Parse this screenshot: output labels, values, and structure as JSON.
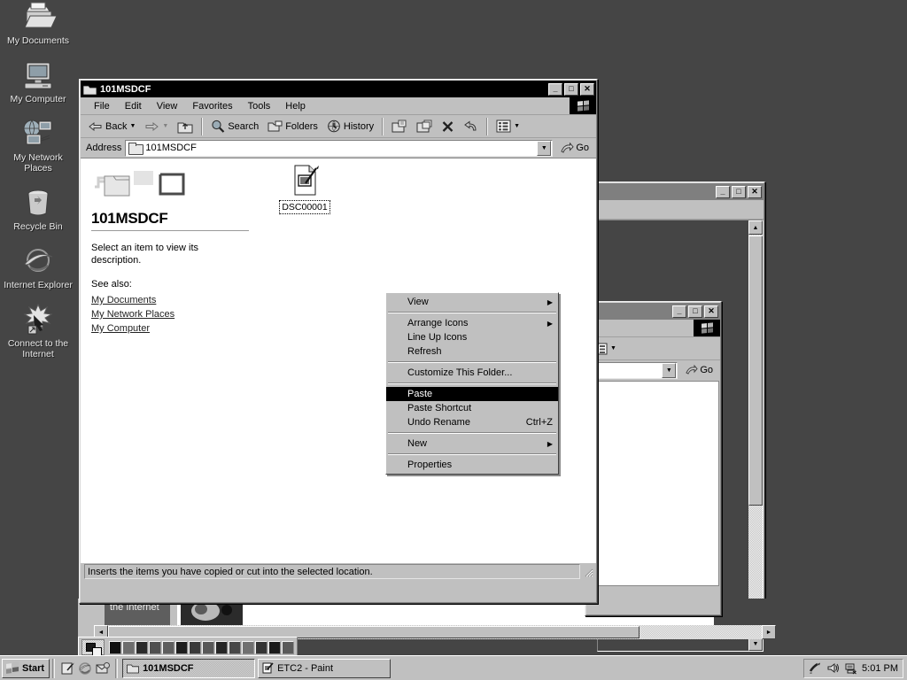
{
  "desktop": {
    "background_color": "#454545",
    "icons": [
      {
        "name": "my-documents",
        "label": "My Documents",
        "icon": "documents-folder-icon"
      },
      {
        "name": "my-computer",
        "label": "My Computer",
        "icon": "computer-icon"
      },
      {
        "name": "my-network-places",
        "label": "My Network Places",
        "icon": "network-icon"
      },
      {
        "name": "recycle-bin",
        "label": "Recycle Bin",
        "icon": "recycle-bin-icon"
      },
      {
        "name": "internet-explorer",
        "label": "Internet Explorer",
        "icon": "internet-explorer-icon"
      },
      {
        "name": "connect-to-internet",
        "label": "Connect to the Internet",
        "icon": "connect-wizard-icon"
      }
    ]
  },
  "explorer": {
    "title": "101MSDCF",
    "title_icon": "folder-icon",
    "window_controls": {
      "minimize": "_",
      "maximize": "□",
      "close": "✕"
    },
    "menus": [
      "File",
      "Edit",
      "View",
      "Favorites",
      "Tools",
      "Help"
    ],
    "toolbar": {
      "back": "Back",
      "forward": "",
      "up": "",
      "search": "Search",
      "folders": "Folders",
      "history": "History",
      "move_to": "",
      "copy_to": "",
      "delete": "",
      "undo": "",
      "views": ""
    },
    "address": {
      "label": "Address",
      "value": "101MSDCF",
      "go_label": "Go"
    },
    "sidebar": {
      "title": "101MSDCF",
      "description": "Select an item to view its description.",
      "see_also_label": "See also:",
      "links": [
        "My Documents",
        "My Network Places",
        "My Computer"
      ]
    },
    "files": [
      {
        "name": "DSC00001",
        "icon": "paint-document-icon",
        "selected": true
      }
    ],
    "status": "Inserts the items you have copied or cut into the selected location."
  },
  "context_menu": {
    "items": [
      {
        "label": "View",
        "submenu": true,
        "accel": "",
        "selected": false,
        "separator_after": true
      },
      {
        "label": "Arrange Icons",
        "submenu": true,
        "accel": "",
        "selected": false,
        "separator_after": false
      },
      {
        "label": "Line Up Icons",
        "submenu": false,
        "accel": "",
        "selected": false,
        "separator_after": false
      },
      {
        "label": "Refresh",
        "submenu": false,
        "accel": "",
        "selected": false,
        "separator_after": true
      },
      {
        "label": "Customize This Folder...",
        "submenu": false,
        "accel": "",
        "selected": false,
        "separator_after": true
      },
      {
        "label": "Paste",
        "submenu": false,
        "accel": "",
        "selected": true,
        "separator_after": false
      },
      {
        "label": "Paste Shortcut",
        "submenu": false,
        "accel": "",
        "selected": false,
        "separator_after": false
      },
      {
        "label": "Undo Rename",
        "submenu": false,
        "accel": "Ctrl+Z",
        "selected": false,
        "separator_after": true
      },
      {
        "label": "New",
        "submenu": true,
        "accel": "",
        "selected": false,
        "separator_after": true
      },
      {
        "label": "Properties",
        "submenu": false,
        "accel": "",
        "selected": false,
        "separator_after": false
      }
    ]
  },
  "background_windows": {
    "window_1": {
      "title": "",
      "controls": {
        "minimize": "_",
        "maximize": "□",
        "close": "✕"
      }
    },
    "window_2": {
      "title": "",
      "controls": {
        "minimize": "_",
        "maximize": "□",
        "close": "✕"
      },
      "address_value": "",
      "go_label": "Go"
    },
    "paint_window": {
      "label": "the Internet"
    }
  },
  "paint_palette": {
    "swatches": [
      "#111111",
      "#6d6d6d",
      "#2a2a2a",
      "#4f4f4f",
      "#5e5e5e",
      "#1d1d1d",
      "#3a3a3a",
      "#585858",
      "#262626",
      "#484848",
      "#707070",
      "#343434",
      "#1a1a1a",
      "#5a5a5a"
    ]
  },
  "taskbar": {
    "start_label": "Start",
    "quick_launch": [
      "show-desktop-icon",
      "internet-explorer-icon",
      "outlook-express-icon"
    ],
    "tasks": [
      {
        "label": "101MSDCF",
        "icon": "folder-icon",
        "active": true
      },
      {
        "label": "ETC2 - Paint",
        "icon": "paint-icon",
        "active": false
      }
    ],
    "tray_icons": [
      "paint-tray-icon",
      "volume-icon",
      "network-icon"
    ],
    "clock": "5:01 PM"
  }
}
